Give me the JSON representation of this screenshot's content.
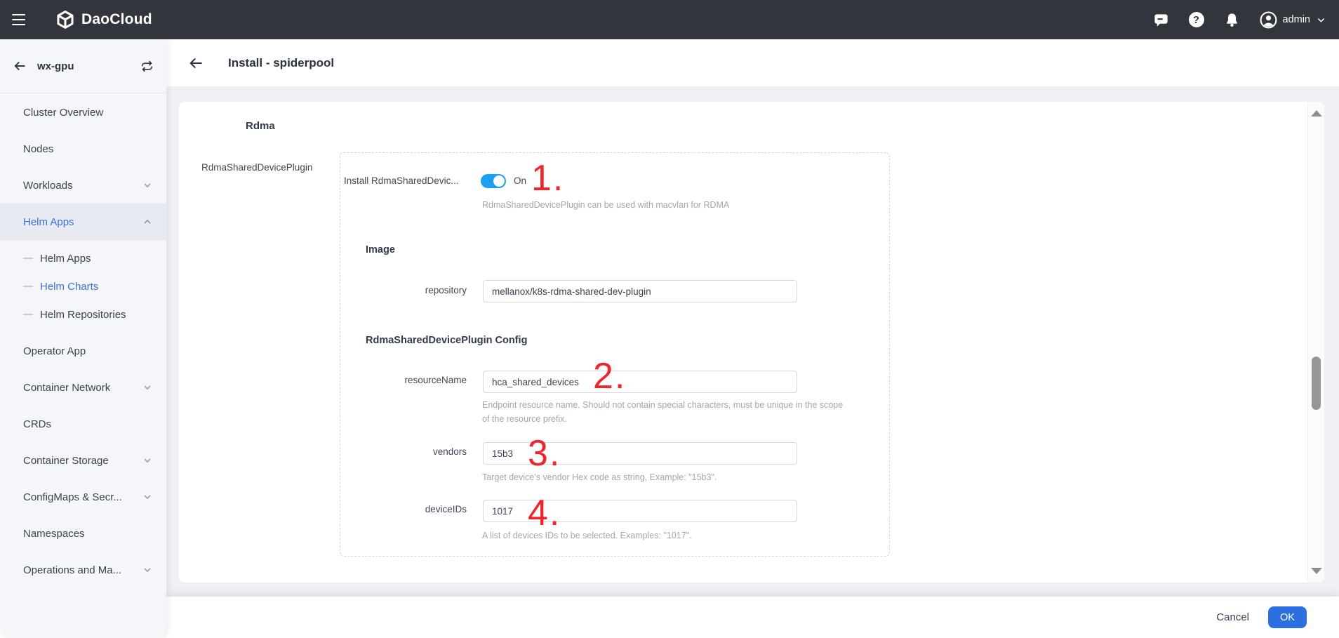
{
  "colors": {
    "topbar_bg": "#32353c",
    "accent_blue": "#3d70dd",
    "toggle_blue": "#1aa1f1",
    "ok_button_blue": "#2e6fe0",
    "annotation_red": "#f0252c"
  },
  "topbar": {
    "brand": "DaoCloud",
    "user": "admin"
  },
  "sidebar": {
    "cluster": "wx-gpu",
    "items": [
      {
        "label": "Cluster Overview"
      },
      {
        "label": "Nodes"
      },
      {
        "label": "Workloads"
      },
      {
        "label": "Helm Apps"
      },
      {
        "label": "Helm Apps"
      },
      {
        "label": "Helm Charts"
      },
      {
        "label": "Helm Repositories"
      },
      {
        "label": "Operator App"
      },
      {
        "label": "Container Network"
      },
      {
        "label": "CRDs"
      },
      {
        "label": "Container Storage"
      },
      {
        "label": "ConfigMaps & Secr..."
      },
      {
        "label": "Namespaces"
      },
      {
        "label": "Operations and Ma..."
      }
    ]
  },
  "header": {
    "title": "Install - spiderpool"
  },
  "form": {
    "section_rdma": "Rdma",
    "group_label": "RdmaSharedDevicePlugin",
    "install_toggle": {
      "label": "Install RdmaSharedDevic...",
      "state": "On",
      "help": "RdmaSharedDevicePlugin can be used with macvlan for RDMA"
    },
    "section_image": "Image",
    "repository": {
      "label": "repository",
      "value": "mellanox/k8s-rdma-shared-dev-plugin"
    },
    "section_config": "RdmaSharedDevicePlugin Config",
    "resourceName": {
      "label": "resourceName",
      "value": "hca_shared_devices",
      "help": "Endpoint resource name. Should not contain special characters, must be unique in the scope of the resource prefix."
    },
    "vendors": {
      "label": "vendors",
      "value": "15b3",
      "help": "Target device's vendor Hex code as string, Example: \"15b3\"."
    },
    "deviceIDs": {
      "label": "deviceIDs",
      "value": "1017",
      "help": "A list of devices IDs to be selected. Examples: \"1017\"."
    }
  },
  "annotations": {
    "n1": "1.",
    "n2": "2.",
    "n3": "3.",
    "n4": "4."
  },
  "footer": {
    "cancel": "Cancel",
    "ok": "OK"
  }
}
